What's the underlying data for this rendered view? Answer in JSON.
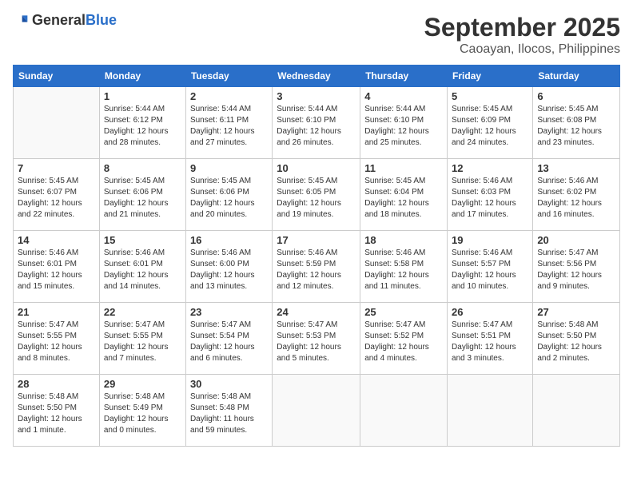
{
  "header": {
    "logo_general": "General",
    "logo_blue": "Blue",
    "month": "September 2025",
    "location": "Caoayan, Ilocos, Philippines"
  },
  "days_of_week": [
    "Sunday",
    "Monday",
    "Tuesday",
    "Wednesday",
    "Thursday",
    "Friday",
    "Saturday"
  ],
  "weeks": [
    [
      {
        "day": "",
        "info": ""
      },
      {
        "day": "1",
        "info": "Sunrise: 5:44 AM\nSunset: 6:12 PM\nDaylight: 12 hours\nand 28 minutes."
      },
      {
        "day": "2",
        "info": "Sunrise: 5:44 AM\nSunset: 6:11 PM\nDaylight: 12 hours\nand 27 minutes."
      },
      {
        "day": "3",
        "info": "Sunrise: 5:44 AM\nSunset: 6:10 PM\nDaylight: 12 hours\nand 26 minutes."
      },
      {
        "day": "4",
        "info": "Sunrise: 5:44 AM\nSunset: 6:10 PM\nDaylight: 12 hours\nand 25 minutes."
      },
      {
        "day": "5",
        "info": "Sunrise: 5:45 AM\nSunset: 6:09 PM\nDaylight: 12 hours\nand 24 minutes."
      },
      {
        "day": "6",
        "info": "Sunrise: 5:45 AM\nSunset: 6:08 PM\nDaylight: 12 hours\nand 23 minutes."
      }
    ],
    [
      {
        "day": "7",
        "info": "Sunrise: 5:45 AM\nSunset: 6:07 PM\nDaylight: 12 hours\nand 22 minutes."
      },
      {
        "day": "8",
        "info": "Sunrise: 5:45 AM\nSunset: 6:06 PM\nDaylight: 12 hours\nand 21 minutes."
      },
      {
        "day": "9",
        "info": "Sunrise: 5:45 AM\nSunset: 6:06 PM\nDaylight: 12 hours\nand 20 minutes."
      },
      {
        "day": "10",
        "info": "Sunrise: 5:45 AM\nSunset: 6:05 PM\nDaylight: 12 hours\nand 19 minutes."
      },
      {
        "day": "11",
        "info": "Sunrise: 5:45 AM\nSunset: 6:04 PM\nDaylight: 12 hours\nand 18 minutes."
      },
      {
        "day": "12",
        "info": "Sunrise: 5:46 AM\nSunset: 6:03 PM\nDaylight: 12 hours\nand 17 minutes."
      },
      {
        "day": "13",
        "info": "Sunrise: 5:46 AM\nSunset: 6:02 PM\nDaylight: 12 hours\nand 16 minutes."
      }
    ],
    [
      {
        "day": "14",
        "info": "Sunrise: 5:46 AM\nSunset: 6:01 PM\nDaylight: 12 hours\nand 15 minutes."
      },
      {
        "day": "15",
        "info": "Sunrise: 5:46 AM\nSunset: 6:01 PM\nDaylight: 12 hours\nand 14 minutes."
      },
      {
        "day": "16",
        "info": "Sunrise: 5:46 AM\nSunset: 6:00 PM\nDaylight: 12 hours\nand 13 minutes."
      },
      {
        "day": "17",
        "info": "Sunrise: 5:46 AM\nSunset: 5:59 PM\nDaylight: 12 hours\nand 12 minutes."
      },
      {
        "day": "18",
        "info": "Sunrise: 5:46 AM\nSunset: 5:58 PM\nDaylight: 12 hours\nand 11 minutes."
      },
      {
        "day": "19",
        "info": "Sunrise: 5:46 AM\nSunset: 5:57 PM\nDaylight: 12 hours\nand 10 minutes."
      },
      {
        "day": "20",
        "info": "Sunrise: 5:47 AM\nSunset: 5:56 PM\nDaylight: 12 hours\nand 9 minutes."
      }
    ],
    [
      {
        "day": "21",
        "info": "Sunrise: 5:47 AM\nSunset: 5:55 PM\nDaylight: 12 hours\nand 8 minutes."
      },
      {
        "day": "22",
        "info": "Sunrise: 5:47 AM\nSunset: 5:55 PM\nDaylight: 12 hours\nand 7 minutes."
      },
      {
        "day": "23",
        "info": "Sunrise: 5:47 AM\nSunset: 5:54 PM\nDaylight: 12 hours\nand 6 minutes."
      },
      {
        "day": "24",
        "info": "Sunrise: 5:47 AM\nSunset: 5:53 PM\nDaylight: 12 hours\nand 5 minutes."
      },
      {
        "day": "25",
        "info": "Sunrise: 5:47 AM\nSunset: 5:52 PM\nDaylight: 12 hours\nand 4 minutes."
      },
      {
        "day": "26",
        "info": "Sunrise: 5:47 AM\nSunset: 5:51 PM\nDaylight: 12 hours\nand 3 minutes."
      },
      {
        "day": "27",
        "info": "Sunrise: 5:48 AM\nSunset: 5:50 PM\nDaylight: 12 hours\nand 2 minutes."
      }
    ],
    [
      {
        "day": "28",
        "info": "Sunrise: 5:48 AM\nSunset: 5:50 PM\nDaylight: 12 hours\nand 1 minute."
      },
      {
        "day": "29",
        "info": "Sunrise: 5:48 AM\nSunset: 5:49 PM\nDaylight: 12 hours\nand 0 minutes."
      },
      {
        "day": "30",
        "info": "Sunrise: 5:48 AM\nSunset: 5:48 PM\nDaylight: 11 hours\nand 59 minutes."
      },
      {
        "day": "",
        "info": ""
      },
      {
        "day": "",
        "info": ""
      },
      {
        "day": "",
        "info": ""
      },
      {
        "day": "",
        "info": ""
      }
    ]
  ]
}
